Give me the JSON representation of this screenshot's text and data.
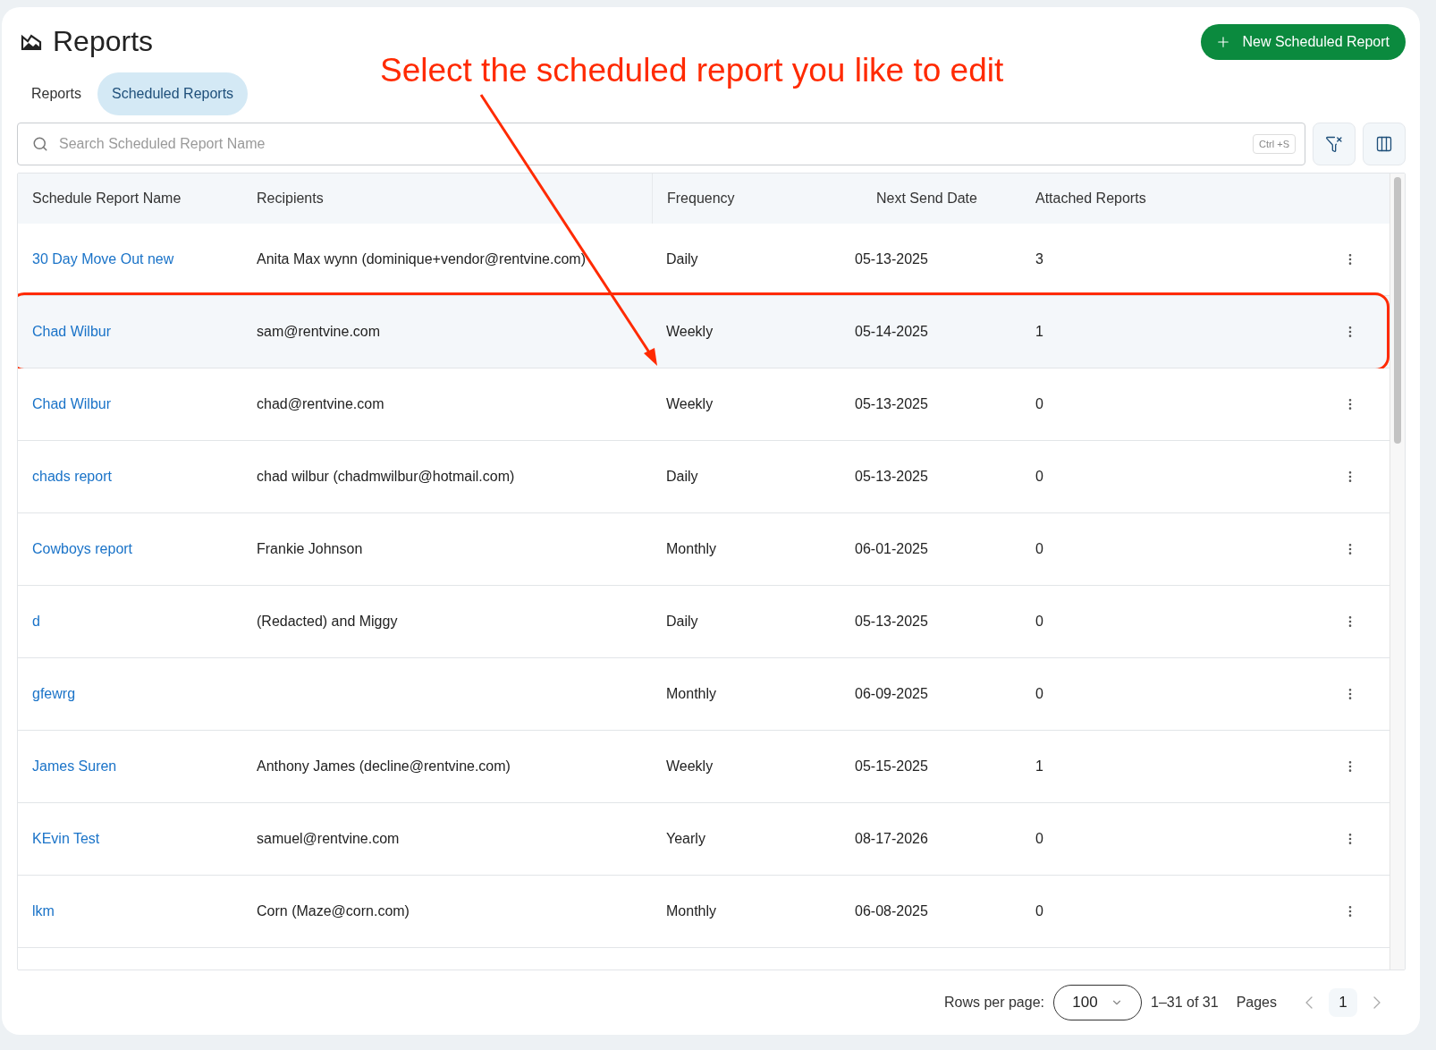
{
  "page": {
    "title": "Reports"
  },
  "new_button": {
    "label": "New Scheduled Report"
  },
  "annotation": {
    "text": "Select the scheduled report you like to edit"
  },
  "tabs": [
    {
      "label": "Reports",
      "selected": false
    },
    {
      "label": "Scheduled Reports",
      "selected": true
    }
  ],
  "search": {
    "placeholder": "Search Scheduled Report Name",
    "shortcut": "Ctrl +S"
  },
  "table": {
    "columns": [
      "Schedule Report Name",
      "Recipients",
      "Frequency",
      "Next Send Date",
      "Attached Reports"
    ],
    "rows": [
      {
        "name": "30 Day Move Out new",
        "recipients": "Anita Max wynn (dominique+vendor@rentvine.com)",
        "frequency": "Daily",
        "next_send_date": "05-13-2025",
        "attached_reports": "3",
        "highlighted": false
      },
      {
        "name": "Chad Wilbur",
        "recipients": "sam@rentvine.com",
        "frequency": "Weekly",
        "next_send_date": "05-14-2025",
        "attached_reports": "1",
        "highlighted": true
      },
      {
        "name": "Chad Wilbur",
        "recipients": "chad@rentvine.com",
        "frequency": "Weekly",
        "next_send_date": "05-13-2025",
        "attached_reports": "0",
        "highlighted": false
      },
      {
        "name": "chads report",
        "recipients": "chad wilbur (chadmwilbur@hotmail.com)",
        "frequency": "Daily",
        "next_send_date": "05-13-2025",
        "attached_reports": "0",
        "highlighted": false
      },
      {
        "name": "Cowboys report",
        "recipients": "Frankie Johnson",
        "frequency": "Monthly",
        "next_send_date": "06-01-2025",
        "attached_reports": "0",
        "highlighted": false
      },
      {
        "name": "d",
        "recipients": "(Redacted) and Miggy",
        "frequency": "Daily",
        "next_send_date": "05-13-2025",
        "attached_reports": "0",
        "highlighted": false
      },
      {
        "name": "gfewrg",
        "frequency": "Monthly",
        "next_send_date": "06-09-2025",
        "attached_reports": "0",
        "highlighted": false
      },
      {
        "name": "James Suren",
        "recipients": "Anthony James (decline@rentvine.com)",
        "frequency": "Weekly",
        "next_send_date": "05-15-2025",
        "attached_reports": "1",
        "highlighted": false
      },
      {
        "name": "KEvin Test",
        "recipients": "samuel@rentvine.com",
        "frequency": "Yearly",
        "next_send_date": "08-17-2026",
        "attached_reports": "0",
        "highlighted": false
      },
      {
        "name": "lkm",
        "recipients": "Corn (Maze@corn.com)",
        "frequency": "Monthly",
        "next_send_date": "06-08-2025",
        "attached_reports": "0",
        "highlighted": false
      }
    ]
  },
  "pagination": {
    "rows_per_page_label": "Rows per page:",
    "rows_per_page": "100",
    "range": "1–31 of 31",
    "pages_label": "Pages",
    "current_page": "1"
  }
}
